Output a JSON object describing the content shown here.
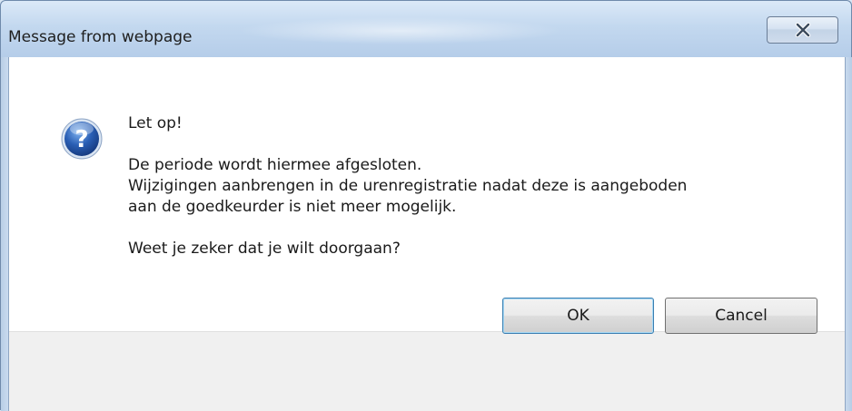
{
  "window": {
    "title": "Message from webpage",
    "close_icon": "close-x-icon"
  },
  "dialog": {
    "icon": "question-icon",
    "icon_color": "#2a5fb5",
    "lines": [
      "Let op!",
      "De periode wordt hiermee afgesloten.",
      "Wijzigingen aanbrengen in de urenregistratie nadat deze is aangeboden",
      "aan de goedkeurder is niet meer mogelijk.",
      "Weet je zeker dat je wilt doorgaan?"
    ]
  },
  "buttons": {
    "ok_label": "OK",
    "cancel_label": "Cancel"
  }
}
